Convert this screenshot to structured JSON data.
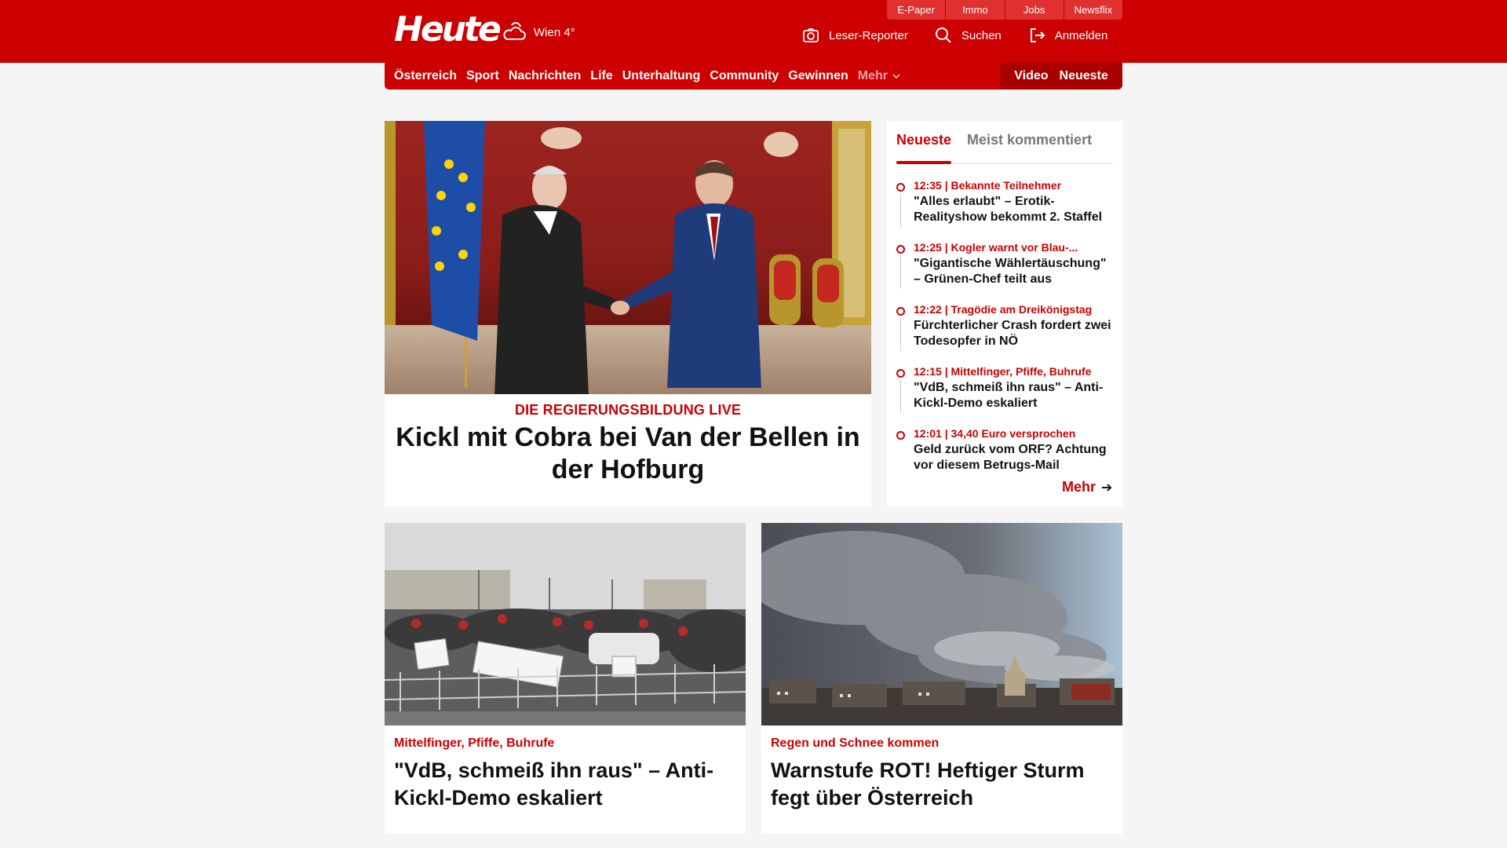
{
  "header": {
    "logo": "Heute",
    "weather": "Wien 4°",
    "service_links": [
      "E-Paper",
      "Immo",
      "Jobs",
      "Newsflix"
    ],
    "actions": {
      "reporter": "Leser-Reporter",
      "search": "Suchen",
      "login": "Anmelden"
    }
  },
  "nav": {
    "items": [
      "Österreich",
      "Sport",
      "Nachrichten",
      "Life",
      "Unterhaltung",
      "Community",
      "Gewinnen"
    ],
    "more": "Mehr",
    "video": "Video",
    "latest": "Neueste"
  },
  "hero": {
    "kicker": "DIE REGIERUNGSBILDUNG LIVE",
    "headline": "Kickl mit Cobra bei Van der Bellen in der Hofburg"
  },
  "sidebar": {
    "tabs": [
      "Neueste",
      "Meist kommentiert"
    ],
    "items": [
      {
        "meta": "12:35 | Bekannte Teilnehmer",
        "title": "\"Alles erlaubt\" – Erotik-Realityshow bekommt 2. Staffel"
      },
      {
        "meta": "12:25 | Kogler warnt vor Blau-...",
        "title": "\"Gigantische Wählertäuschung\" – Grünen-Chef teilt aus"
      },
      {
        "meta": "12:22 | Tragödie am Dreikönigstag",
        "title": "Fürchterlicher Crash fordert zwei Todesopfer in NÖ"
      },
      {
        "meta": "12:15 | Mittelfinger, Pfiffe, Buhrufe",
        "title": "\"VdB, schmeiß ihn raus\" – Anti-Kickl-Demo eskaliert"
      },
      {
        "meta": "12:01 | 34,40 Euro versprochen",
        "title": "Geld zurück vom ORF? Achtung vor diesem Betrugs-Mail"
      }
    ],
    "more": "Mehr"
  },
  "cards": [
    {
      "kicker": "Mittelfinger, Pfiffe, Buhrufe",
      "headline": "\"VdB, schmeiß ihn raus\" – Anti-Kickl-Demo eskaliert"
    },
    {
      "kicker": "Regen und Schnee kommen",
      "headline": "Warnstufe ROT! Heftiger Sturm fegt über Österreich"
    }
  ],
  "colors": {
    "brand": "#cc0000",
    "brand_dark": "#a80000",
    "page_bg": "#f5f5f5"
  }
}
